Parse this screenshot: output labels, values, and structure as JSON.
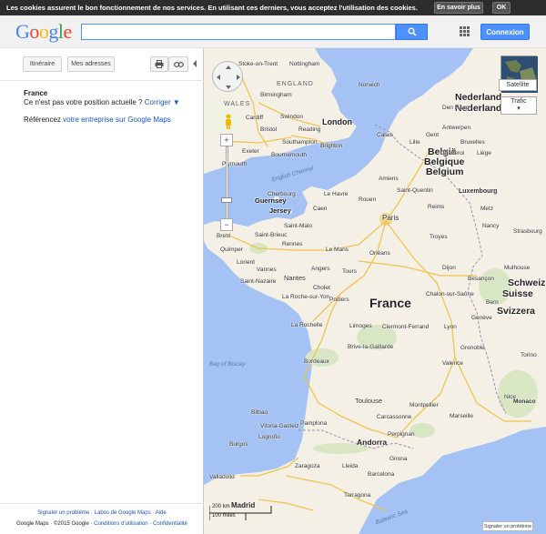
{
  "cookie_bar": {
    "text": "Les cookies assurent le bon fonctionnement de nos services. En utilisant ces derniers, vous acceptez l'utilisation des cookies.",
    "more_label": "En savoir plus",
    "ok_label": "OK"
  },
  "header": {
    "logo_letters": [
      "G",
      "o",
      "o",
      "g",
      "l",
      "e"
    ],
    "search_value": "",
    "search_icon": "search-icon",
    "apps_icon": "apps-grid-icon",
    "signin_label": "Connexion"
  },
  "side_panel": {
    "buttons": {
      "directions_label": "Itinéraire",
      "my_places_label": "Mes adresses",
      "print_icon": "print-icon",
      "link_icon": "link-icon"
    },
    "location_title": "France",
    "location_question": "Ce n'est pas votre position actuelle ?",
    "correct_link": "Corriger ▼",
    "business_prefix": "Référencez",
    "business_link": "votre entreprise sur Google Maps",
    "footer": {
      "links_line": "Signaler un problème · Labos de Google Maps · Aide",
      "copyright_prefix": "Google Maps · ©2015 Google ·",
      "terms_link": "Conditions d'utilisation",
      "separator": "·",
      "privacy_link": "Confidentialité"
    }
  },
  "map": {
    "controls": {
      "satellite_label": "Satellite",
      "traffic_label": "Trafic",
      "traffic_arrow": "▾",
      "zoom_in": "+",
      "zoom_out": "−",
      "scale_km": "200 km",
      "scale_mi": "100 miles",
      "report_label": "Signaler un problème"
    },
    "labels": {
      "england": "ENGLAND",
      "wales": "WALES",
      "nederland": "Nederland",
      "belgie": "België",
      "belgique": "Belgique",
      "belgium": "Belgium",
      "luxembourg": "Luxembourg",
      "france": "France",
      "schweiz": "Schweiz",
      "suisse": "Suisse",
      "svizzera": "Svizzera",
      "monaco": "Monaco",
      "andorra": "Andorra",
      "english_channel": "English Channel",
      "bay_of_biscay": "Bay of Biscay",
      "guernsey": "Guernsey",
      "jersey": "Jersey",
      "balearic_sea": "Balearic Sea",
      "stoke": "Stoke-on-Trent",
      "nottingham": "Nottingham",
      "birmingham": "Birmingham",
      "norwich": "Norwich",
      "cardiff": "Cardiff",
      "swindon": "Swindon",
      "bristol": "Bristol",
      "reading": "Reading",
      "london": "London",
      "southampton": "Southampton",
      "brighton": "Brighton",
      "exeter": "Exeter",
      "bournemouth": "Bournemouth",
      "plymouth": "Plymouth",
      "den_haag": "Den Haag",
      "antwerpen": "Antwerpen",
      "gent": "Gent",
      "lille": "Lille",
      "bruxelles": "Bruxelles",
      "calais": "Calais",
      "charleroi": "Charleroi",
      "liege": "Liège",
      "amiens": "Amiens",
      "le_havre": "Le Havre",
      "rouen": "Rouen",
      "saint_quentin": "Saint-Quentin",
      "cherbourg": "Cherbourg",
      "caen": "Caen",
      "reims": "Reims",
      "metz": "Metz",
      "saint_malo": "Saint-Malo",
      "saint_brieuc": "Saint-Brieuc",
      "brest": "Brest",
      "quimper": "Quimper",
      "rennes": "Rennes",
      "le_mans": "Le Mans",
      "paris": "Paris",
      "strasbourg": "Strasbourg",
      "orleans": "Orléans",
      "troyes": "Troyes",
      "nancy": "Nancy",
      "vannes": "Vannes",
      "lorient": "Lorient",
      "angers": "Angers",
      "tours": "Tours",
      "dijon": "Dijon",
      "mulhouse": "Mulhouse",
      "saint_nazaire": "Saint-Nazaire",
      "nantes": "Nantes",
      "cholet": "Cholet",
      "besancon": "Besançon",
      "la_roche": "La Roche-sur-Yon",
      "poitiers": "Poitiers",
      "chalon": "Chalon-sur-Saône",
      "bern": "Bern",
      "la_rochelle": "La Rochelle",
      "limoges": "Limoges",
      "clermont": "Clermont-Ferrand",
      "lyon": "Lyon",
      "geneve": "Genève",
      "torino": "Torino",
      "brive": "Brive-la-Gaillarde",
      "grenoble": "Grenoble",
      "bordeaux": "Bordeaux",
      "valence": "Valence",
      "toulouse": "Toulouse",
      "montpellier": "Montpellier",
      "nice": "Nice",
      "marseille": "Marseille",
      "bilbao": "Bilbao",
      "pamplona": "Pamplona",
      "carcassonne": "Carcassonne",
      "perpignan": "Perpignan",
      "vitoria": "Vitoria-Gasteiz",
      "logrono": "Logroño",
      "burgos": "Burgos",
      "zaragoza": "Zaragoza",
      "girona": "Girona",
      "lleida": "Lleida",
      "barcelona": "Barcelona",
      "valladolid": "Valladolid",
      "tarragona": "Tarragona",
      "madrid": "Madrid"
    }
  }
}
